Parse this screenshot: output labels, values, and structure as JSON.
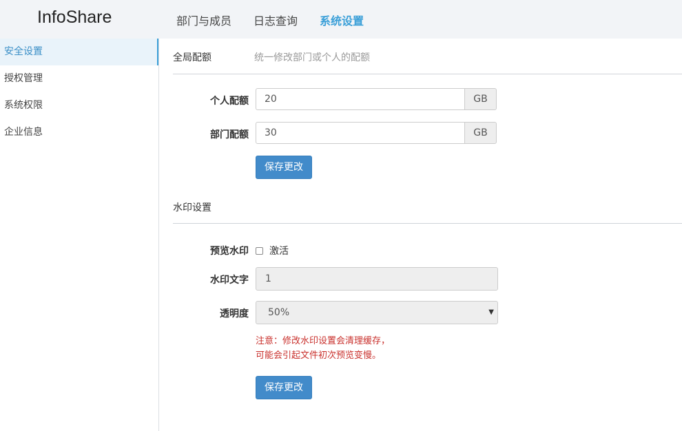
{
  "app": {
    "title": "InfoShare"
  },
  "nav": {
    "items": [
      "部门与成员",
      "日志查询",
      "系统设置"
    ],
    "active": "系统设置"
  },
  "sidebar": {
    "items": [
      "安全设置",
      "授权管理",
      "系统权限",
      "企业信息"
    ],
    "active": "安全设置"
  },
  "quota": {
    "heading": "全局配额",
    "description": "统一修改部门或个人的配额",
    "personal_label": "个人配额",
    "personal_value": "20",
    "department_label": "部门配额",
    "department_value": "30",
    "unit": "GB",
    "save_label": "保存更改"
  },
  "watermark": {
    "heading": "水印设置",
    "preview_label": "预览水印",
    "activate_label": "激活",
    "activate_checked": false,
    "text_label": "水印文字",
    "text_value": "1",
    "opacity_label": "透明度",
    "opacity_value": "50%",
    "note_line1": "注意：修改水印设置会清理缓存，",
    "note_line2": "可能会引起文件初次预览变慢。",
    "save_label": "保存更改"
  },
  "colors": {
    "accent": "#3a9fd8",
    "button": "#428bca",
    "warning": "#c9302c"
  }
}
